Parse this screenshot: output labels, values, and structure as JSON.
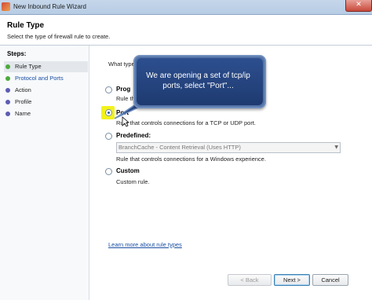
{
  "window": {
    "title": "New Inbound Rule Wizard",
    "close_glyph": "✕"
  },
  "header": {
    "title": "Rule Type",
    "description": "Select the type of firewall rule to create."
  },
  "steps": {
    "title": "Steps:",
    "items": [
      {
        "label": "Rule Type",
        "color": "#4caa3c",
        "active": true
      },
      {
        "label": "Protocol and Ports",
        "color": "#4caa3c",
        "active": false,
        "link": true
      },
      {
        "label": "Action",
        "color": "#5c5cb3",
        "active": false
      },
      {
        "label": "Profile",
        "color": "#5c5cb3",
        "active": false
      },
      {
        "label": "Name",
        "color": "#5c5cb3",
        "active": false
      }
    ]
  },
  "content": {
    "question": "What type",
    "options": [
      {
        "label": "Prog",
        "desc": "Rule th",
        "selected": false
      },
      {
        "label": "Port",
        "desc": "Rule that controls connections for a TCP or UDP port.",
        "selected": true
      },
      {
        "label": "Predefined:",
        "desc": "Rule that controls connections for a Windows experience.",
        "selected": false
      },
      {
        "label": "Custom",
        "desc": "Custom rule.",
        "selected": false
      }
    ],
    "predefined_value": "BranchCache - Content Retrieval (Uses HTTP)",
    "learn_more_link": "Learn more about rule types"
  },
  "callout": {
    "text": "We are opening a set of tcp/ip ports, select \"Port\"..."
  },
  "buttons": {
    "back": "< Back",
    "next": "Next >",
    "cancel": "Cancel"
  },
  "colors": {
    "highlight": "#f2f21d",
    "callout_bg": "#2d4f8f",
    "link": "#1a4fa3"
  }
}
